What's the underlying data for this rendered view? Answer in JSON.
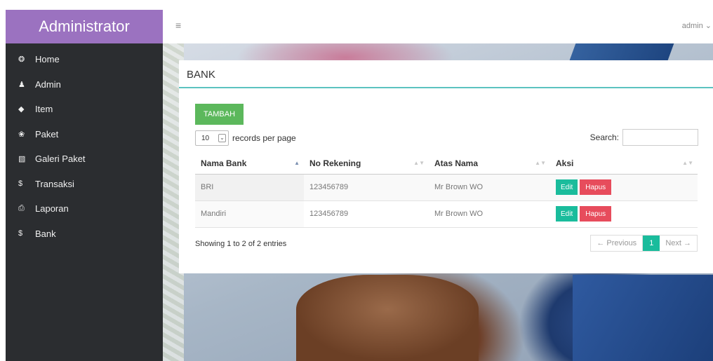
{
  "sidebar": {
    "brand": "Administrator",
    "items": [
      {
        "label": "Home",
        "icon": "dashboard-icon",
        "glyph": "❂"
      },
      {
        "label": "Admin",
        "icon": "user-icon",
        "glyph": "♟"
      },
      {
        "label": "Item",
        "icon": "cube-icon",
        "glyph": "◆"
      },
      {
        "label": "Paket",
        "icon": "gift-icon",
        "glyph": "❀"
      },
      {
        "label": "Galeri Paket",
        "icon": "image-icon",
        "glyph": "▧"
      },
      {
        "label": "Transaksi",
        "icon": "dollar-icon",
        "glyph": "$"
      },
      {
        "label": "Laporan",
        "icon": "print-icon",
        "glyph": "⎙"
      },
      {
        "label": "Bank",
        "icon": "dollar-icon",
        "glyph": "$"
      }
    ]
  },
  "topbar": {
    "menu_glyph": "≡",
    "user_label": "admin ⌄"
  },
  "panel": {
    "title": "BANK",
    "add_label": "TAMBAH",
    "length_value": "10",
    "length_suffix": "records per page",
    "search_label": "Search:",
    "columns": [
      "Nama Bank",
      "No Rekening",
      "Atas Nama",
      "Aksi"
    ],
    "rows": [
      {
        "nama_bank": "BRI",
        "no_rekening": "123456789",
        "atas_nama": "Mr Brown WO",
        "edit": "Edit",
        "hapus": "Hapus"
      },
      {
        "nama_bank": "Mandiri",
        "no_rekening": "123456789",
        "atas_nama": "Mr Brown WO",
        "edit": "Edit",
        "hapus": "Hapus"
      }
    ],
    "info": "Showing 1 to 2 of 2 entries",
    "pager": {
      "prev": "← Previous",
      "current": "1",
      "next": "Next →"
    }
  },
  "colors": {
    "brand": "#9b72c0",
    "sidebar": "#2b2d30",
    "accent": "#1abc9c",
    "add_button": "#5cb85c",
    "delete_button": "#e74c5c"
  }
}
